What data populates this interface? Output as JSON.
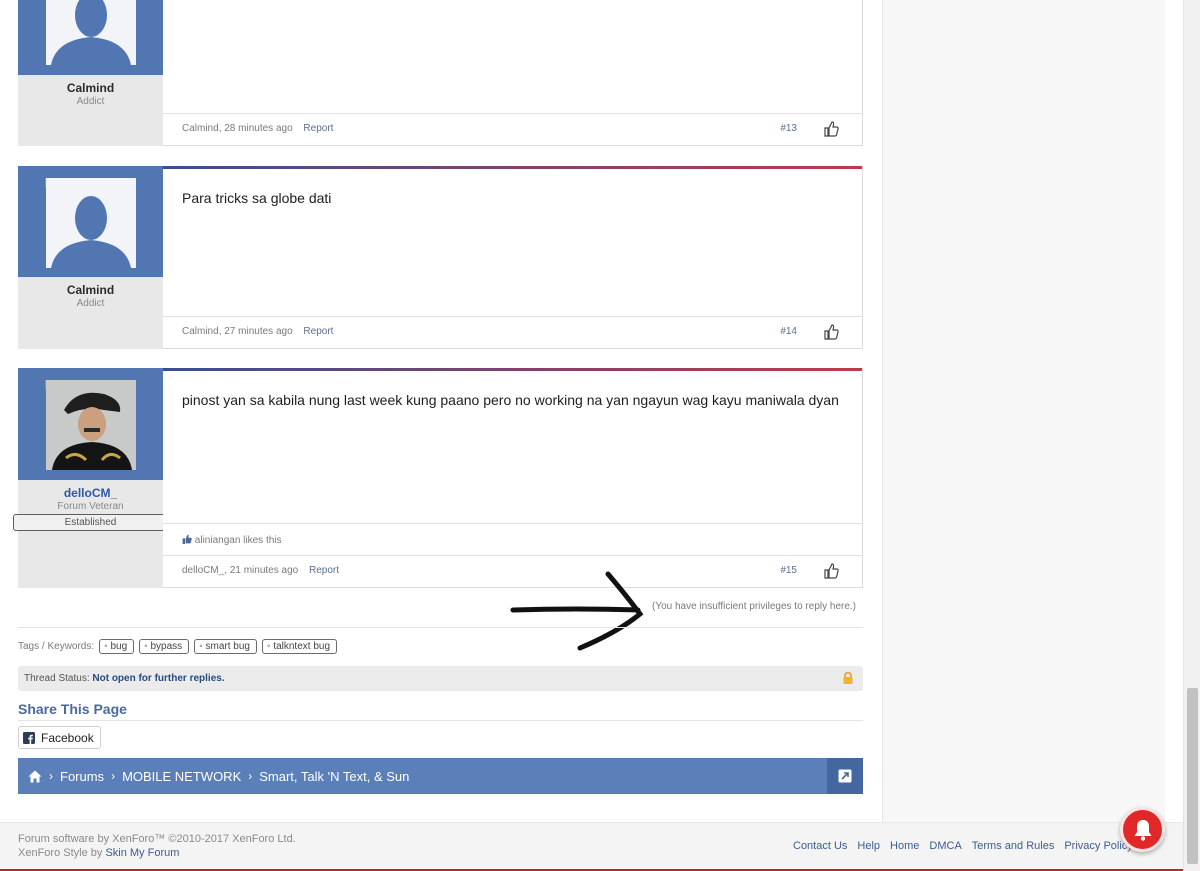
{
  "posts": [
    {
      "username": "Calmind",
      "user_title": "Addict",
      "message": "",
      "author": "Calmind",
      "time": "28 minutes ago",
      "report_label": "Report",
      "post_number": "#13"
    },
    {
      "username": "Calmind",
      "user_title": "Addict",
      "message": "Para tricks sa globe dati",
      "author": "Calmind",
      "time": "27 minutes ago",
      "report_label": "Report",
      "post_number": "#14"
    },
    {
      "username": "delloCM_",
      "user_title": "Forum Veteran",
      "user_banner": "Established",
      "message": "pinost yan sa kabila nung last week kung paano pero no working na yan ngayun wag kayu maniwala dyan",
      "likes_text": "aliniangan likes this",
      "author": "delloCM_",
      "time": "21 minutes ago",
      "report_label": "Report",
      "post_number": "#15"
    }
  ],
  "reply_note": "(You have insufficient privileges to reply here.)",
  "tags": {
    "label": "Tags / Keywords:",
    "items": [
      "bug",
      "bypass",
      "smart bug",
      "talkntext bug"
    ]
  },
  "thread_status": {
    "label": "Thread Status:",
    "value": "Not open for further replies."
  },
  "share": {
    "title": "Share This Page",
    "facebook_label": "Facebook"
  },
  "breadcrumb": {
    "items": [
      "Forums",
      "MOBILE NETWORK",
      "Smart, Talk 'N Text, & Sun"
    ]
  },
  "footer": {
    "copyright": "Forum software by XenForo™ ©2010-2017 XenForo Ltd.",
    "style_prefix": "XenForo Style by",
    "style_link": "Skin My Forum",
    "links": [
      "Contact Us",
      "Help",
      "Home",
      "DMCA",
      "Terms and Rules",
      "Privacy Policy"
    ]
  },
  "colors": {
    "accent_blue": "#5b7fb9",
    "post_divider_red": "#c0394a",
    "online_green": "#6cb52d",
    "notification_red": "#e12828"
  }
}
